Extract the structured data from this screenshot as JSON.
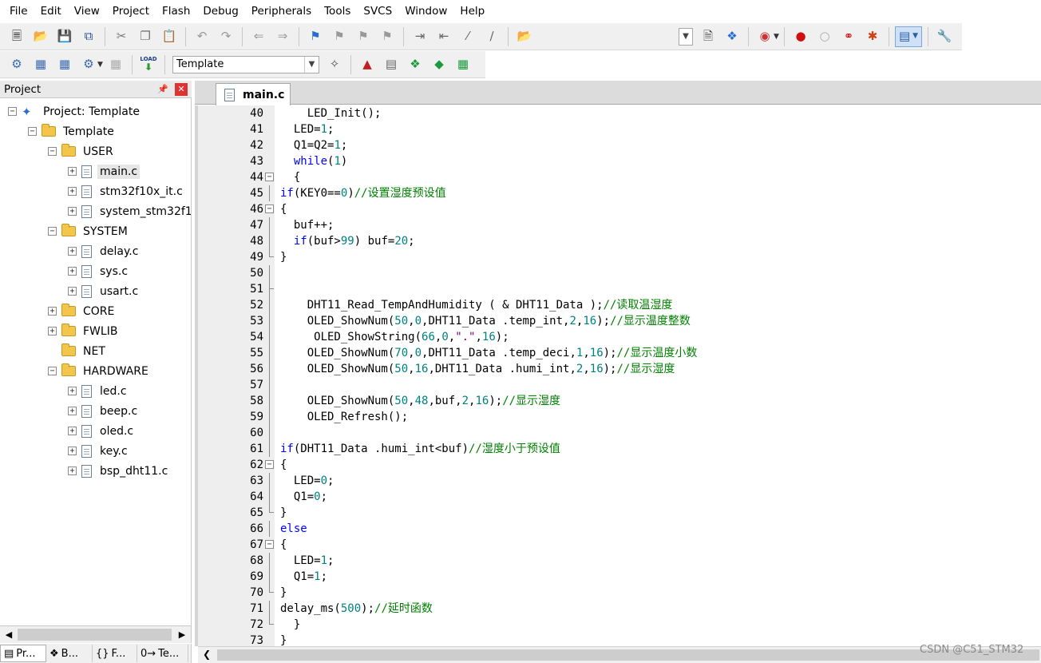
{
  "menu": [
    "File",
    "Edit",
    "View",
    "Project",
    "Flash",
    "Debug",
    "Peripherals",
    "Tools",
    "SVCS",
    "Window",
    "Help"
  ],
  "toolbar1": {
    "icons": [
      "new-file-icon",
      "open-file-icon",
      "save-icon",
      "save-all-icon",
      "cut-icon",
      "copy-icon",
      "paste-icon",
      "undo-icon",
      "redo-icon",
      "navigate-back-icon",
      "navigate-forward-icon",
      "bookmark-icon",
      "prev-bookmark-icon",
      "next-bookmark-icon",
      "clear-bookmarks-icon",
      "indent-icon",
      "unindent-icon",
      "comment-icon",
      "uncomment-icon",
      "find-in-files-icon"
    ],
    "right_icons": [
      "find-combo-icon",
      "incremental-find-icon",
      "debug-session-icon",
      "insert-breakpoint-icon",
      "enable-breakpoint-icon",
      "disable-breakpoints-icon",
      "kill-breakpoints-icon",
      "window-layout-icon",
      "configure-icon"
    ]
  },
  "toolbar2": {
    "target_combo": "Template",
    "icons": [
      "translate-icon",
      "build-icon",
      "rebuild-icon",
      "batch-build-icon",
      "stop-build-icon",
      "download-icon"
    ],
    "load_label": "LOAD",
    "right_icons": [
      "options-for-target-icon",
      "manage-project-icon",
      "file-extensions-icon",
      "manage-run-time-icon",
      "select-software-packs-icon",
      "pack-installer-icon"
    ]
  },
  "project_panel": {
    "title": "Project",
    "pin": "一",
    "tree": [
      {
        "level": 0,
        "type": "project",
        "label": "Project: Template",
        "exp": "−"
      },
      {
        "level": 1,
        "type": "folder",
        "label": "Template",
        "exp": "−"
      },
      {
        "level": 2,
        "type": "folder",
        "label": "USER",
        "exp": "−"
      },
      {
        "level": 3,
        "type": "file",
        "label": "main.c",
        "exp": "+",
        "selected": true
      },
      {
        "level": 3,
        "type": "file",
        "label": "stm32f10x_it.c",
        "exp": "+"
      },
      {
        "level": 3,
        "type": "file",
        "label": "system_stm32f1",
        "exp": "+"
      },
      {
        "level": 2,
        "type": "folder",
        "label": "SYSTEM",
        "exp": "−"
      },
      {
        "level": 3,
        "type": "file",
        "label": "delay.c",
        "exp": "+"
      },
      {
        "level": 3,
        "type": "file",
        "label": "sys.c",
        "exp": "+"
      },
      {
        "level": 3,
        "type": "file",
        "label": "usart.c",
        "exp": "+"
      },
      {
        "level": 2,
        "type": "folder",
        "label": "CORE",
        "exp": "+"
      },
      {
        "level": 2,
        "type": "folder",
        "label": "FWLIB",
        "exp": "+"
      },
      {
        "level": 2,
        "type": "folder",
        "label": "NET",
        "exp": ""
      },
      {
        "level": 2,
        "type": "folder",
        "label": "HARDWARE",
        "exp": "−"
      },
      {
        "level": 3,
        "type": "file",
        "label": "led.c",
        "exp": "+"
      },
      {
        "level": 3,
        "type": "file",
        "label": "beep.c",
        "exp": "+"
      },
      {
        "level": 3,
        "type": "file",
        "label": "oled.c",
        "exp": "+"
      },
      {
        "level": 3,
        "type": "file",
        "label": "key.c",
        "exp": "+"
      },
      {
        "level": 3,
        "type": "file",
        "label": "bsp_dht11.c",
        "exp": "+"
      }
    ],
    "bottom_tabs": [
      {
        "icon": "▤",
        "label": "Pr...",
        "active": true
      },
      {
        "icon": "❖",
        "label": "B..."
      },
      {
        "icon": "{}",
        "label": "F..."
      },
      {
        "icon": "0→",
        "label": "Te..."
      }
    ]
  },
  "editor": {
    "active_tab": "main.c",
    "lines": [
      {
        "n": "40",
        "fold": "",
        "segs": [
          {
            "t": "    LED_Init();"
          }
        ]
      },
      {
        "n": "41",
        "fold": "",
        "segs": [
          {
            "t": "  LED="
          },
          {
            "t": "1",
            "c": "num"
          },
          {
            "t": ";"
          }
        ]
      },
      {
        "n": "42",
        "fold": "",
        "segs": [
          {
            "t": "  Q1=Q2="
          },
          {
            "t": "1",
            "c": "num"
          },
          {
            "t": ";"
          }
        ]
      },
      {
        "n": "43",
        "fold": "",
        "segs": [
          {
            "t": "  "
          },
          {
            "t": "while",
            "c": "kw"
          },
          {
            "t": "("
          },
          {
            "t": "1",
            "c": "num"
          },
          {
            "t": ")"
          }
        ]
      },
      {
        "n": "44",
        "fold": "open",
        "segs": [
          {
            "t": "  {"
          }
        ]
      },
      {
        "n": "45",
        "fold": "line",
        "segs": [
          {
            "t": "if",
            "c": "kw"
          },
          {
            "t": "(KEY0=="
          },
          {
            "t": "0",
            "c": "num"
          },
          {
            "t": ")"
          },
          {
            "t": "//设置湿度预设值",
            "c": "cm"
          }
        ]
      },
      {
        "n": "46",
        "fold": "open",
        "segs": [
          {
            "t": "{"
          }
        ]
      },
      {
        "n": "47",
        "fold": "line",
        "segs": [
          {
            "t": "  buf++;"
          }
        ]
      },
      {
        "n": "48",
        "fold": "line",
        "segs": [
          {
            "t": "  "
          },
          {
            "t": "if",
            "c": "kw"
          },
          {
            "t": "(buf>"
          },
          {
            "t": "99",
            "c": "num"
          },
          {
            "t": ") buf="
          },
          {
            "t": "20",
            "c": "num"
          },
          {
            "t": ";"
          }
        ]
      },
      {
        "n": "49",
        "fold": "end",
        "segs": [
          {
            "t": "}"
          }
        ]
      },
      {
        "n": "50",
        "fold": "line",
        "segs": []
      },
      {
        "n": "51",
        "fold": "dash",
        "segs": []
      },
      {
        "n": "52",
        "fold": "line",
        "segs": [
          {
            "t": "    DHT11_Read_TempAndHumidity ( & DHT11_Data );"
          },
          {
            "t": "//读取温湿度",
            "c": "cm"
          }
        ]
      },
      {
        "n": "53",
        "fold": "line",
        "segs": [
          {
            "t": "    OLED_ShowNum("
          },
          {
            "t": "50",
            "c": "num"
          },
          {
            "t": ","
          },
          {
            "t": "0",
            "c": "num"
          },
          {
            "t": ",DHT11_Data .temp_int,"
          },
          {
            "t": "2",
            "c": "num"
          },
          {
            "t": ","
          },
          {
            "t": "16",
            "c": "num"
          },
          {
            "t": ");"
          },
          {
            "t": "//显示温度整数",
            "c": "cm"
          }
        ]
      },
      {
        "n": "54",
        "fold": "line",
        "segs": [
          {
            "t": "     OLED_ShowString("
          },
          {
            "t": "66",
            "c": "num"
          },
          {
            "t": ","
          },
          {
            "t": "0",
            "c": "num"
          },
          {
            "t": ","
          },
          {
            "t": "\".\"",
            "c": "str"
          },
          {
            "t": ","
          },
          {
            "t": "16",
            "c": "num"
          },
          {
            "t": ");"
          }
        ]
      },
      {
        "n": "55",
        "fold": "line",
        "segs": [
          {
            "t": "    OLED_ShowNum("
          },
          {
            "t": "70",
            "c": "num"
          },
          {
            "t": ","
          },
          {
            "t": "0",
            "c": "num"
          },
          {
            "t": ",DHT11_Data .temp_deci,"
          },
          {
            "t": "1",
            "c": "num"
          },
          {
            "t": ","
          },
          {
            "t": "16",
            "c": "num"
          },
          {
            "t": ");"
          },
          {
            "t": "//显示温度小数",
            "c": "cm"
          }
        ]
      },
      {
        "n": "56",
        "fold": "line",
        "segs": [
          {
            "t": "    OLED_ShowNum("
          },
          {
            "t": "50",
            "c": "num"
          },
          {
            "t": ","
          },
          {
            "t": "16",
            "c": "num"
          },
          {
            "t": ",DHT11_Data .humi_int,"
          },
          {
            "t": "2",
            "c": "num"
          },
          {
            "t": ","
          },
          {
            "t": "16",
            "c": "num"
          },
          {
            "t": ");"
          },
          {
            "t": "//显示湿度",
            "c": "cm"
          }
        ]
      },
      {
        "n": "57",
        "fold": "line",
        "segs": []
      },
      {
        "n": "58",
        "fold": "line",
        "segs": [
          {
            "t": "    OLED_ShowNum("
          },
          {
            "t": "50",
            "c": "num"
          },
          {
            "t": ","
          },
          {
            "t": "48",
            "c": "num"
          },
          {
            "t": ",buf,"
          },
          {
            "t": "2",
            "c": "num"
          },
          {
            "t": ","
          },
          {
            "t": "16",
            "c": "num"
          },
          {
            "t": ");"
          },
          {
            "t": "//显示湿度",
            "c": "cm"
          }
        ]
      },
      {
        "n": "59",
        "fold": "line",
        "segs": [
          {
            "t": "    OLED_Refresh();"
          }
        ]
      },
      {
        "n": "60",
        "fold": "line",
        "segs": []
      },
      {
        "n": "61",
        "fold": "line",
        "segs": [
          {
            "t": "if",
            "c": "kw"
          },
          {
            "t": "(DHT11_Data .humi_int<buf)"
          },
          {
            "t": "//湿度小于预设值",
            "c": "cm"
          }
        ]
      },
      {
        "n": "62",
        "fold": "open",
        "segs": [
          {
            "t": "{"
          }
        ]
      },
      {
        "n": "63",
        "fold": "line",
        "segs": [
          {
            "t": "  LED="
          },
          {
            "t": "0",
            "c": "num"
          },
          {
            "t": ";"
          }
        ]
      },
      {
        "n": "64",
        "fold": "line",
        "segs": [
          {
            "t": "  Q1="
          },
          {
            "t": "0",
            "c": "num"
          },
          {
            "t": ";"
          }
        ]
      },
      {
        "n": "65",
        "fold": "end",
        "segs": [
          {
            "t": "}"
          }
        ]
      },
      {
        "n": "66",
        "fold": "line",
        "segs": [
          {
            "t": "else",
            "c": "kw"
          }
        ]
      },
      {
        "n": "67",
        "fold": "open",
        "segs": [
          {
            "t": "{"
          }
        ]
      },
      {
        "n": "68",
        "fold": "line",
        "segs": [
          {
            "t": "  LED="
          },
          {
            "t": "1",
            "c": "num"
          },
          {
            "t": ";"
          }
        ]
      },
      {
        "n": "69",
        "fold": "line",
        "segs": [
          {
            "t": "  Q1="
          },
          {
            "t": "1",
            "c": "num"
          },
          {
            "t": ";"
          }
        ]
      },
      {
        "n": "70",
        "fold": "end",
        "segs": [
          {
            "t": "}"
          }
        ]
      },
      {
        "n": "71",
        "fold": "line",
        "segs": [
          {
            "t": "delay_ms("
          },
          {
            "t": "500",
            "c": "num"
          },
          {
            "t": ");"
          },
          {
            "t": "//延时函数",
            "c": "cm"
          }
        ]
      },
      {
        "n": "72",
        "fold": "end",
        "segs": [
          {
            "t": "  }"
          }
        ]
      },
      {
        "n": "73",
        "fold": "",
        "segs": [
          {
            "t": "}"
          }
        ]
      }
    ]
  },
  "colors": {
    "keyword": "#0000ff",
    "number": "#008080",
    "comment": "#008000",
    "string": "#800080"
  },
  "watermark": "CSDN @C51_STM32"
}
